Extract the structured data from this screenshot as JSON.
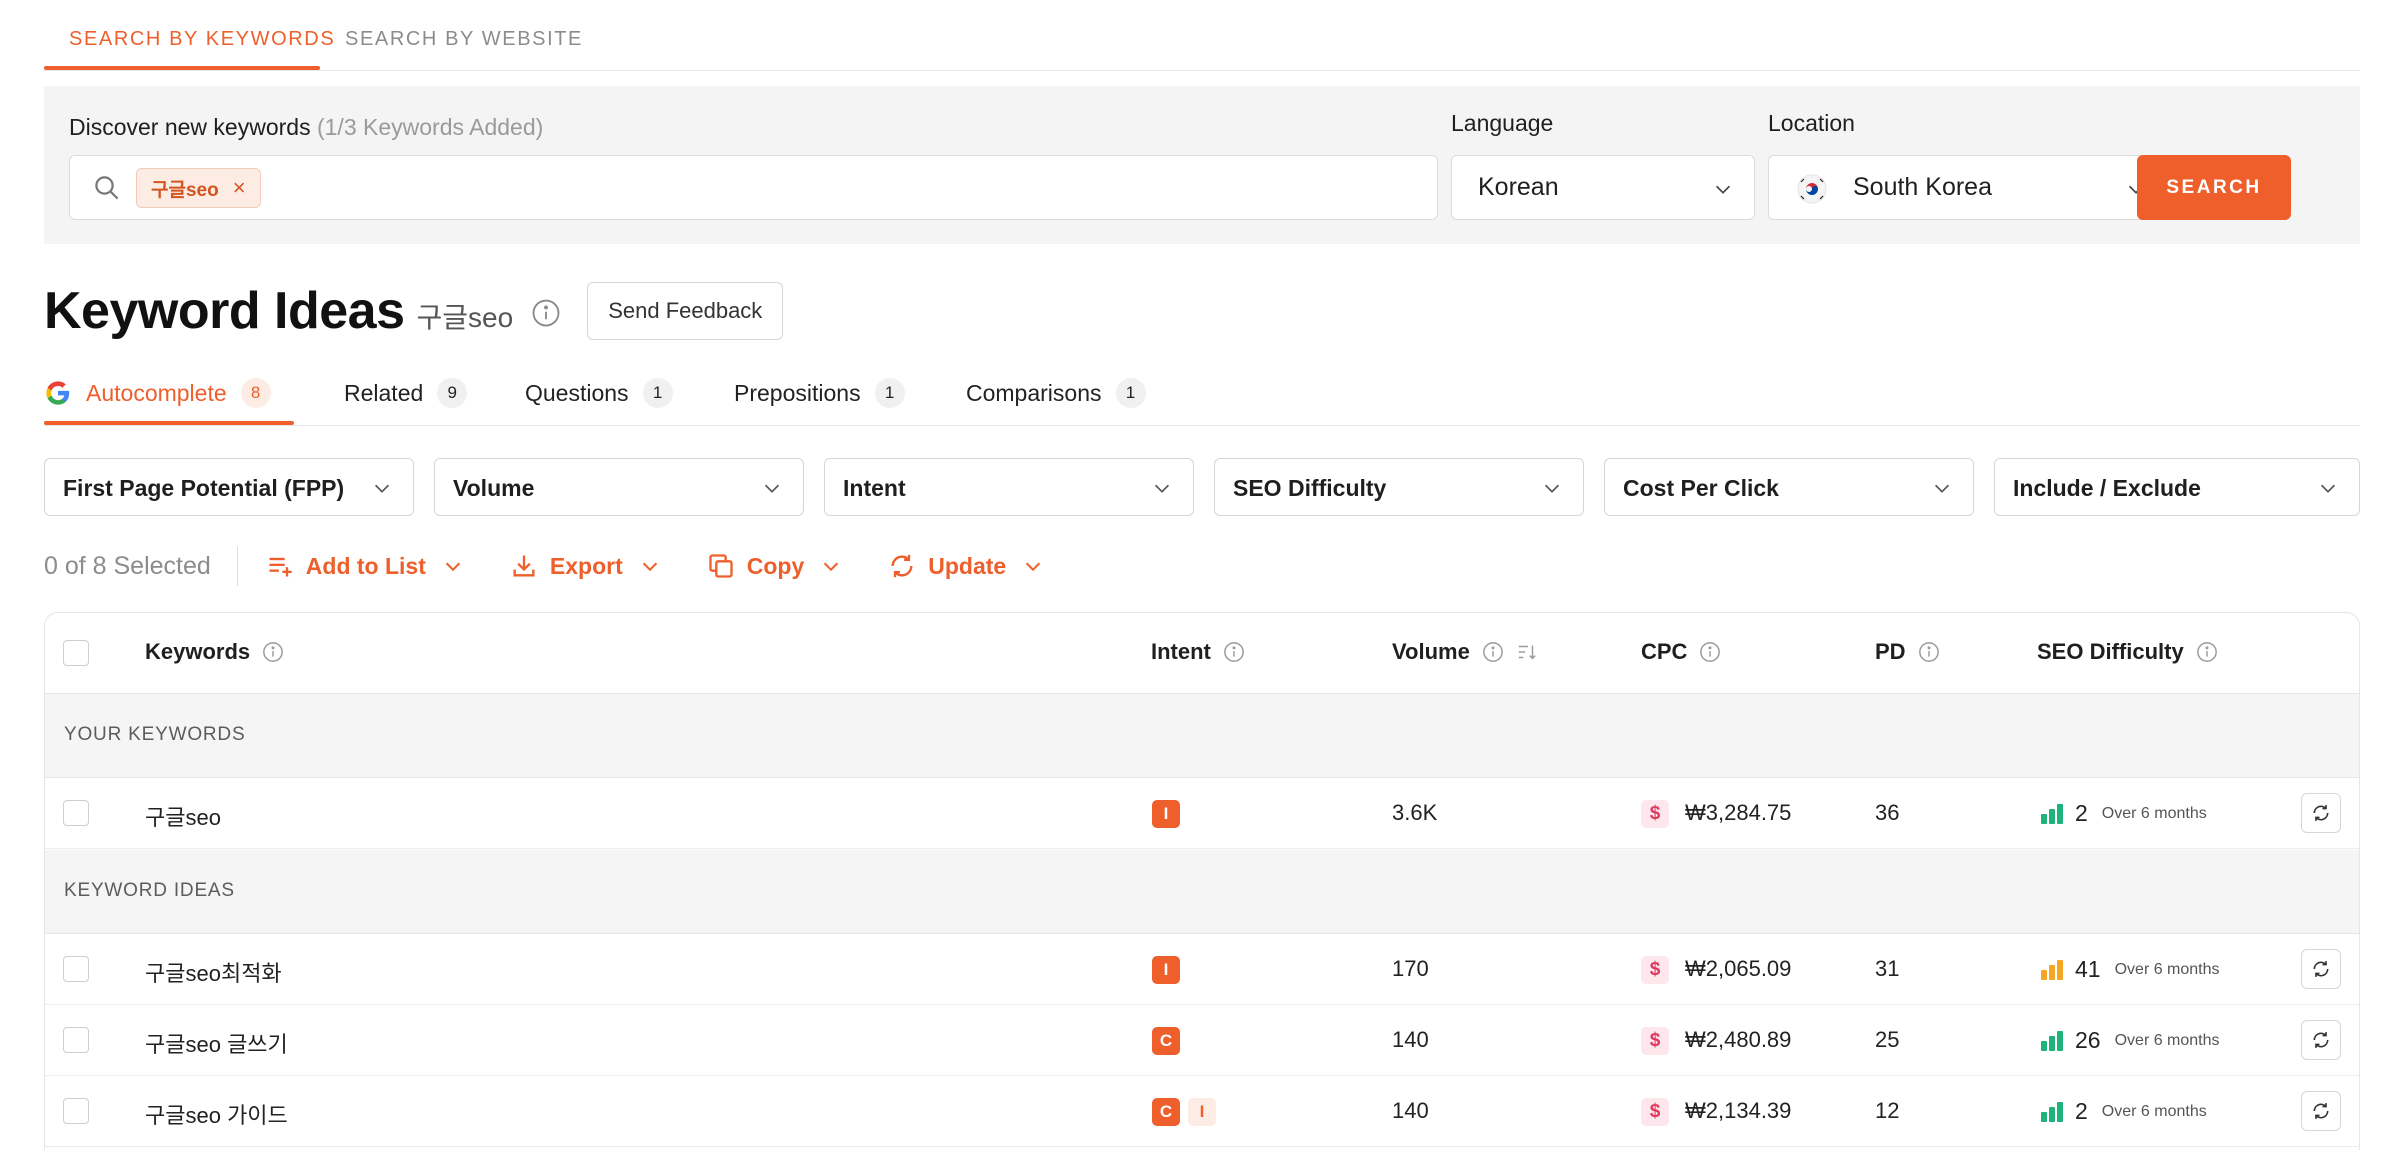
{
  "top_tabs": [
    {
      "label": "SEARCH BY KEYWORDS",
      "active": true
    },
    {
      "label": "SEARCH BY WEBSITE",
      "active": false
    }
  ],
  "search": {
    "discover_label": "Discover new keywords",
    "discover_count": "(1/3 Keywords Added)",
    "chip": "구글seo",
    "language_label": "Language",
    "language_value": "Korean",
    "location_label": "Location",
    "location_value": "South Korea",
    "search_button": "SEARCH"
  },
  "heading": {
    "title": "Keyword Ideas",
    "keyword": "구글seo",
    "feedback_button": "Send Feedback"
  },
  "idea_tabs": [
    {
      "label": "Autocomplete",
      "count": "8",
      "active": true
    },
    {
      "label": "Related",
      "count": "9",
      "active": false
    },
    {
      "label": "Questions",
      "count": "1",
      "active": false
    },
    {
      "label": "Prepositions",
      "count": "1",
      "active": false
    },
    {
      "label": "Comparisons",
      "count": "1",
      "active": false
    }
  ],
  "filters": [
    "First Page Potential (FPP)",
    "Volume",
    "Intent",
    "SEO Difficulty",
    "Cost Per Click",
    "Include / Exclude"
  ],
  "actions": {
    "selected": "0 of 8 Selected",
    "add_to_list": "Add to List",
    "export": "Export",
    "copy": "Copy",
    "update": "Update"
  },
  "table": {
    "headers": {
      "keywords": "Keywords",
      "intent": "Intent",
      "volume": "Volume",
      "cpc": "CPC",
      "pd": "PD",
      "seo_difficulty": "SEO Difficulty"
    },
    "section_your": "YOUR KEYWORDS",
    "section_ideas": "KEYWORD IDEAS",
    "your_rows": [
      {
        "keyword": "구글seo",
        "intent": [
          "I"
        ],
        "volume": "3.6K",
        "cpc": "₩3,284.75",
        "pd": "36",
        "difficulty": "2",
        "updated": "Over 6 months",
        "level": "easy"
      }
    ],
    "idea_rows": [
      {
        "keyword": "구글seo최적화",
        "intent": [
          "I"
        ],
        "volume": "170",
        "cpc": "₩2,065.09",
        "pd": "31",
        "difficulty": "41",
        "updated": "Over 6 months",
        "level": "medium"
      },
      {
        "keyword": "구글seo 글쓰기",
        "intent": [
          "C"
        ],
        "volume": "140",
        "cpc": "₩2,480.89",
        "pd": "25",
        "difficulty": "26",
        "updated": "Over 6 months",
        "level": "easy"
      },
      {
        "keyword": "구글seo 가이드",
        "intent": [
          "C",
          "I"
        ],
        "volume": "140",
        "cpc": "₩2,134.39",
        "pd": "12",
        "difficulty": "2",
        "updated": "Over 6 months",
        "level": "easy"
      }
    ]
  },
  "colors": {
    "accent": "#ee5f2b",
    "easy": "#1db37a",
    "medium": "#f5a623",
    "cpc": "#e0385d"
  }
}
